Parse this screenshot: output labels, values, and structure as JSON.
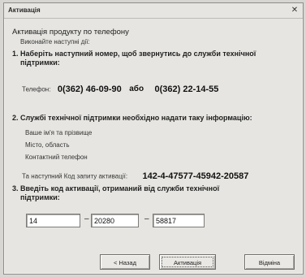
{
  "window": {
    "title": "Активація",
    "close_glyph": "✕"
  },
  "header": {
    "heading": "Активація продукту по телефону",
    "subheading": "Виконайте наступні дії:"
  },
  "step1": {
    "line1": "1. Наберіть наступний номер, щоб звернутись до служби технічної",
    "line2": "підтримки:",
    "phone_label": "Телефон:",
    "phone1": "0(362) 46-09-90",
    "separator": "або",
    "phone2": "0(362) 22-14-55"
  },
  "step2": {
    "text": "2. Службі технічної підтримки необхідно надати таку інформацію:",
    "info_items": [
      "Ваше ім'я та прізвище",
      "Місто, область",
      "Контактний телефон"
    ],
    "request_label": "Та наступний Код запиту активації:",
    "request_code": "142-4-47577-45942-20587"
  },
  "step3": {
    "line1": "3. Введіть код активації, отриманий від служби технічної",
    "line2": "підтримки:",
    "code_values": [
      "14",
      "20280",
      "58817"
    ],
    "dash": "–"
  },
  "buttons": {
    "back": "< Назад",
    "activate": "Активація",
    "cancel": "Відміна"
  }
}
